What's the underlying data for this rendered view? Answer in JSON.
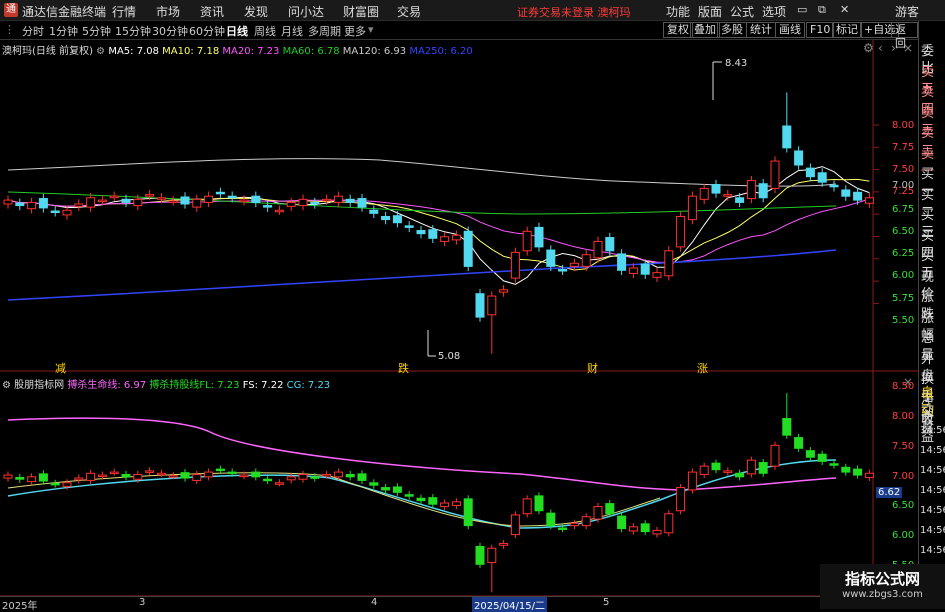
{
  "app": {
    "name": "通达信金融终端",
    "logo_glyph": "通"
  },
  "menu": [
    "行情",
    "市场",
    "资讯",
    "发现",
    "问小达",
    "财富圈",
    "交易"
  ],
  "warning": "证券交易未登录  澳柯玛",
  "right_menu": [
    "功能",
    "版面",
    "公式",
    "选项"
  ],
  "guest": "游客",
  "periods": [
    "分时",
    "1分钟",
    "5分钟",
    "15分钟",
    "30分钟",
    "60分钟",
    "日线",
    "周线",
    "月线",
    "多周期",
    "更多"
  ],
  "active_period": "日线",
  "right_tools": [
    "复权",
    "叠加",
    "多股",
    "统计",
    "画线",
    "F10",
    "标记",
    "+自选",
    "返回"
  ],
  "main_legend": {
    "title": "澳柯玛(日线 前复权)",
    "ma5": "MA5: 7.08",
    "ma10": "MA10: 7.18",
    "ma20": "MA20: 7.23",
    "ma60": "MA60: 6.78",
    "ma120": "MA120: 6.93",
    "ma250": "MA250: 6.20"
  },
  "sub_legend": {
    "title": "股朋指标网",
    "life": "搏杀生命线: 6.97",
    "fl": "搏杀持股线FL: 7.23",
    "fs": "FS: 7.22",
    "cg": "CG: 7.23"
  },
  "main_axis": [
    "8.00",
    "7.75",
    "7.50",
    "7.25",
    "7.00",
    "6.75",
    "6.50",
    "6.25",
    "6.00",
    "5.75",
    "5.50"
  ],
  "sub_axis": [
    "8.50",
    "8.00",
    "7.50",
    "7.00",
    "6.50",
    "6.00",
    "5.50"
  ],
  "sub_current": "6.62",
  "annotations": {
    "high": "8.43",
    "low": "5.08",
    "m1": "减",
    "m2": "跌",
    "m3": "财",
    "m4": "涨"
  },
  "dates": {
    "d0": "2025年",
    "d1": "3",
    "d2": "4",
    "d3": "2025/04/15/二",
    "d4": "5"
  },
  "side_items": [
    "委比",
    "卖五",
    "卖四",
    "卖三",
    "卖二",
    "卖一",
    "买一",
    "买二",
    "买三",
    "买四",
    "买五",
    "现价",
    "涨跌",
    "涨幅",
    "总量",
    "外盘",
    "换手",
    "净资",
    "收益"
  ],
  "side_items2": [
    "自动",
    "交易"
  ],
  "side_times": [
    "14:56",
    "14:56",
    "14:56",
    "14:56",
    "14:56",
    "14:56",
    "14:56"
  ],
  "watermark": {
    "big": "指标公式网",
    "small": "www.zbgs3.com"
  },
  "colors": {
    "up": "#ff3030",
    "down": "#52d9f0",
    "sub_down": "#22dd22",
    "ma5": "#ffffff",
    "ma10": "#ffff66",
    "ma20": "#ff55ff",
    "ma60": "#22cc22",
    "ma120": "#cccccc",
    "ma250": "#3344ff"
  }
}
